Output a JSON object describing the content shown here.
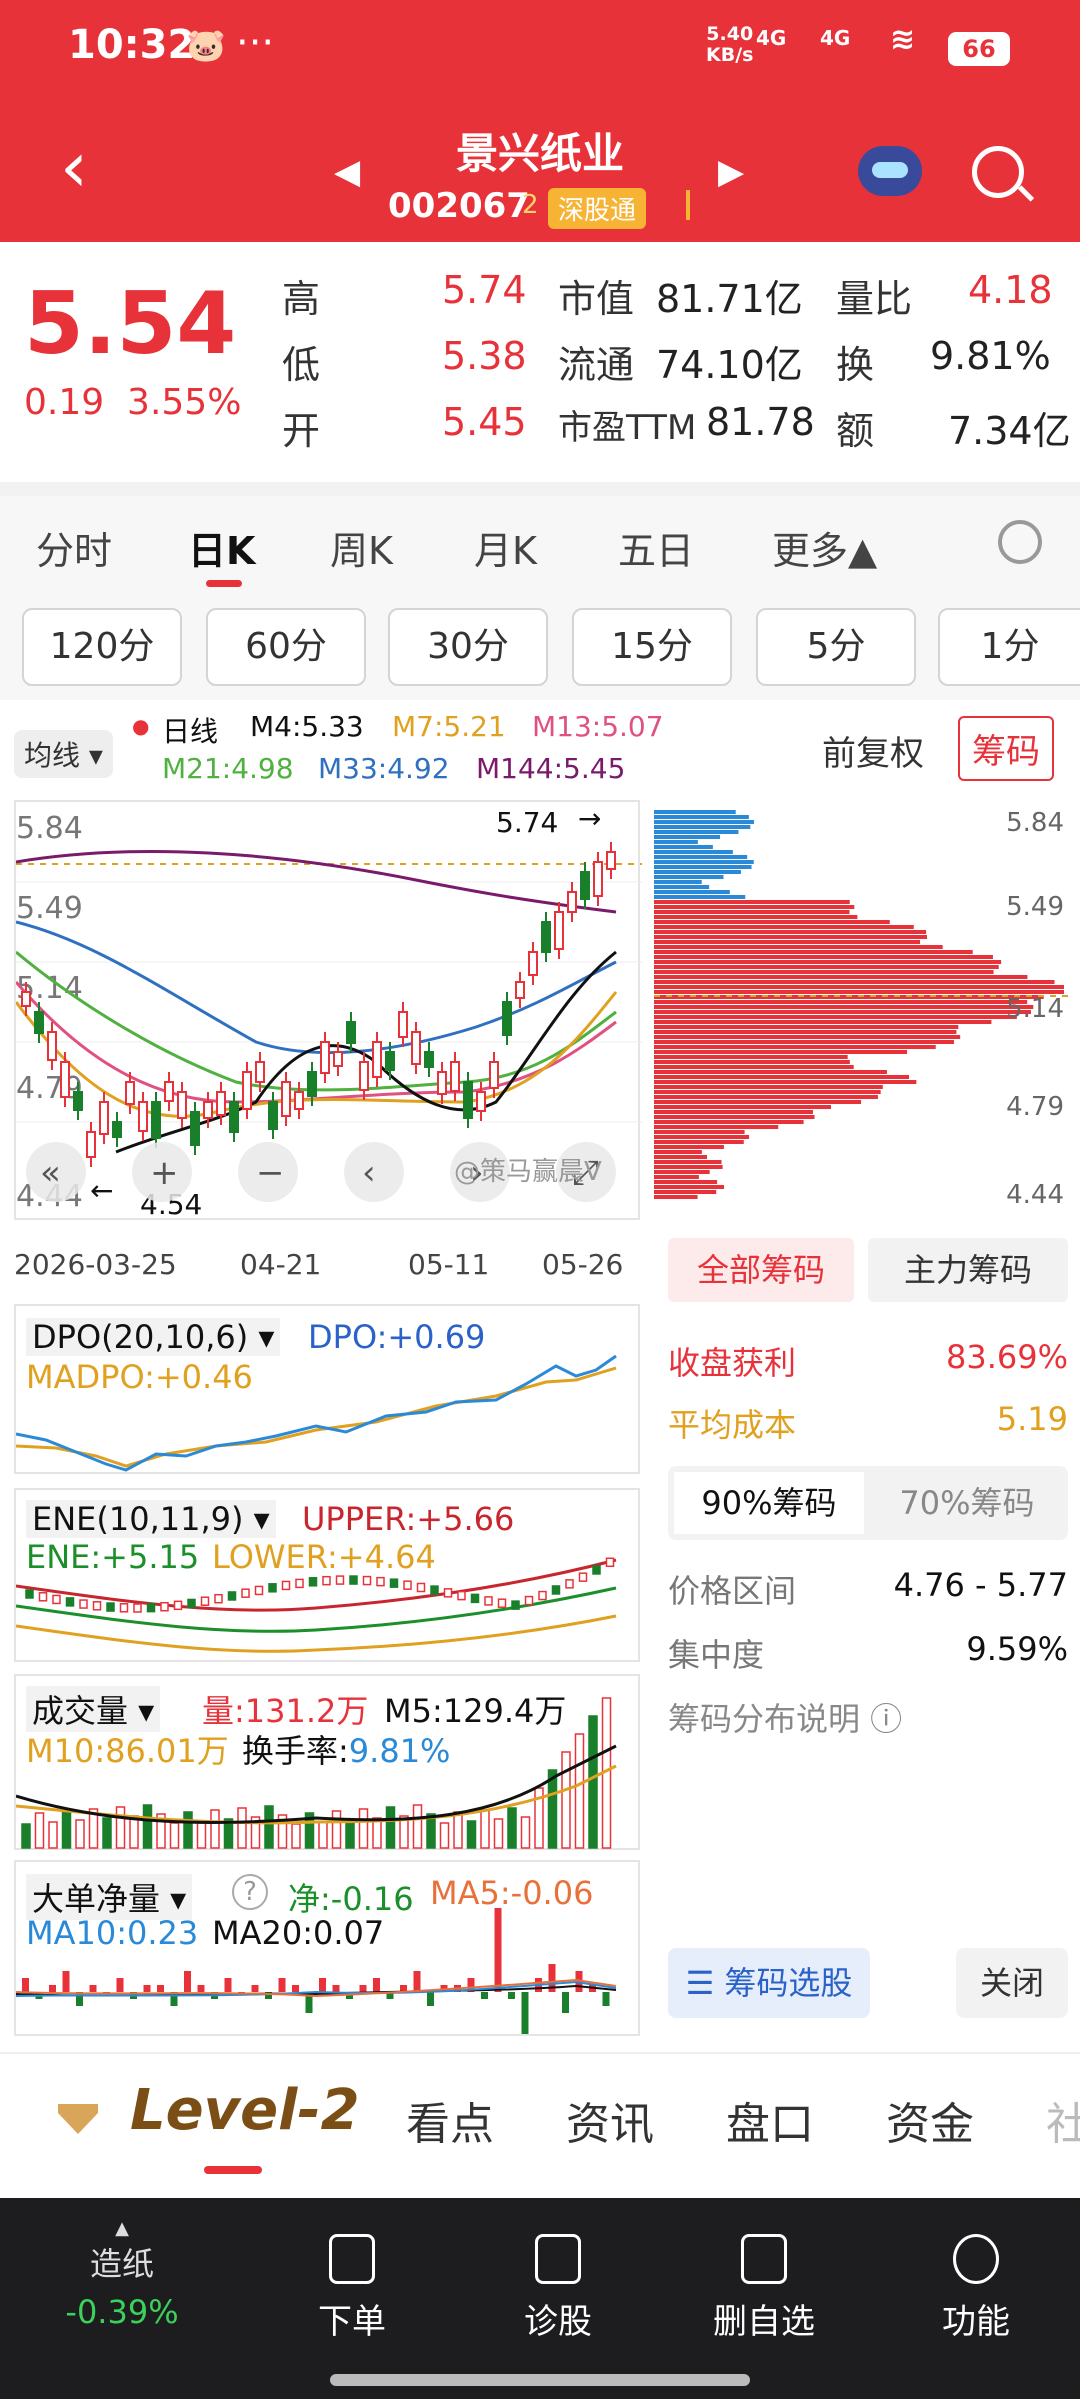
{
  "statusbar": {
    "time": "10:32",
    "dots": "···",
    "speed_value": "5.40",
    "speed_unit": "KB/s",
    "signal1": "4G",
    "signal2": "4G",
    "battery": "66"
  },
  "header": {
    "name": "景兴纸业",
    "code": "002067",
    "level_tag": "2",
    "market_tag": "深股通"
  },
  "quote": {
    "price": "5.54",
    "change": "0.19",
    "change_pct": "3.55%",
    "high_label": "高",
    "high": "5.74",
    "low_label": "低",
    "low": "5.38",
    "open_label": "开",
    "open": "5.45",
    "mcap_label": "市值",
    "mcap": "81.71亿",
    "float_label": "流通",
    "float": "74.10亿",
    "pe_label": "市盈TTM",
    "pe": "81.78",
    "vr_label": "量比",
    "vr": "4.18",
    "turn_label": "换",
    "turn": "9.81%",
    "amt_label": "额",
    "amt": "7.34亿"
  },
  "ktabs": [
    "分时",
    "日K",
    "周K",
    "月K",
    "五日",
    "更多▲"
  ],
  "periods": [
    "120分",
    "60分",
    "30分",
    "15分",
    "5分",
    "1分"
  ],
  "ma": {
    "selector": "均线 ▾",
    "day": "日线",
    "m4": "M4:5.33",
    "m7": "M7:5.21",
    "m13": "M13:5.07",
    "m21": "M21:4.98",
    "m33": "M33:4.92",
    "m144": "M144:5.45",
    "qfq": "前复权",
    "chouma": "筹码"
  },
  "kchart": {
    "y_labels": [
      "5.84",
      "5.49",
      "5.14",
      "4.79",
      "4.44"
    ],
    "high_note": "5.74",
    "low_note": "4.54",
    "dates": [
      "2026-03-25",
      "04-21",
      "05-11",
      "05-26"
    ],
    "watermark": "@策马赢晨V",
    "colors": {
      "up": "#e8323a",
      "down": "#1a7f2a",
      "m4": "#111111",
      "m7": "#e0a020",
      "m13": "#e05080",
      "m21": "#50b040",
      "m33": "#3070c0",
      "m144": "#7a1a6a"
    }
  },
  "chouma": {
    "y_labels": [
      "5.84",
      "5.49",
      "5.14",
      "4.79",
      "4.44"
    ],
    "tab_all": "全部筹码",
    "tab_main": "主力筹码",
    "profit_label": "收盘获利",
    "profit": "83.69%",
    "avg_label": "平均成本",
    "avg": "5.19",
    "tab90": "90%筹码",
    "tab70": "70%筹码",
    "range_label": "价格区间",
    "range": "4.76 - 5.77",
    "conc_label": "集中度",
    "conc": "9.59%",
    "explain": "筹码分布说明 ⓘ",
    "select_btn": "筹码选股",
    "close_btn": "关闭"
  },
  "dpo": {
    "title": "DPO(20,10,6) ▾",
    "dpo": "DPO:+0.69",
    "madpo": "MADPO:+0.46"
  },
  "ene": {
    "title": "ENE(10,11,9) ▾",
    "upper": "UPPER:+5.66",
    "ene": "ENE:+5.15",
    "lower": "LOWER:+4.64"
  },
  "vol": {
    "title": "成交量 ▾",
    "vol": "量:131.2万",
    "m5": "M5:129.4万",
    "m10": "M10:86.01万",
    "hs_label": "换手率:",
    "hs": "9.81%"
  },
  "big": {
    "title": "大单净量 ▾",
    "help": "?",
    "net": "净:-0.16",
    "ma5": "MA5:-0.06",
    "ma10": "MA10:0.23",
    "ma20": "MA20:0.07"
  },
  "nav2": [
    "Level-2",
    "看点",
    "资讯",
    "盘口",
    "资金",
    "社"
  ],
  "bottom": {
    "sector": "造纸",
    "sector_chg": "-0.39%",
    "items": [
      "下单",
      "诊股",
      "删自选",
      "功能"
    ]
  }
}
